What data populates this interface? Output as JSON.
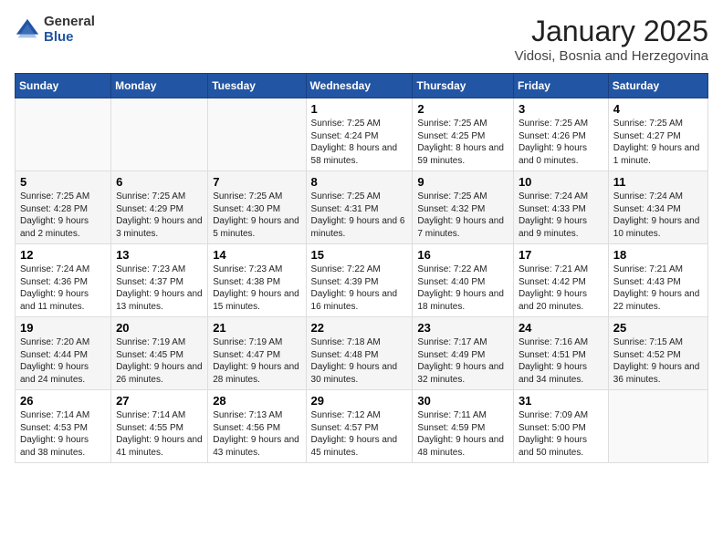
{
  "logo": {
    "general": "General",
    "blue": "Blue"
  },
  "title": "January 2025",
  "location": "Vidosi, Bosnia and Herzegovina",
  "days_of_week": [
    "Sunday",
    "Monday",
    "Tuesday",
    "Wednesday",
    "Thursday",
    "Friday",
    "Saturday"
  ],
  "weeks": [
    [
      {
        "day": "",
        "info": ""
      },
      {
        "day": "",
        "info": ""
      },
      {
        "day": "",
        "info": ""
      },
      {
        "day": "1",
        "info": "Sunrise: 7:25 AM\nSunset: 4:24 PM\nDaylight: 8 hours and 58 minutes."
      },
      {
        "day": "2",
        "info": "Sunrise: 7:25 AM\nSunset: 4:25 PM\nDaylight: 8 hours and 59 minutes."
      },
      {
        "day": "3",
        "info": "Sunrise: 7:25 AM\nSunset: 4:26 PM\nDaylight: 9 hours and 0 minutes."
      },
      {
        "day": "4",
        "info": "Sunrise: 7:25 AM\nSunset: 4:27 PM\nDaylight: 9 hours and 1 minute."
      }
    ],
    [
      {
        "day": "5",
        "info": "Sunrise: 7:25 AM\nSunset: 4:28 PM\nDaylight: 9 hours and 2 minutes."
      },
      {
        "day": "6",
        "info": "Sunrise: 7:25 AM\nSunset: 4:29 PM\nDaylight: 9 hours and 3 minutes."
      },
      {
        "day": "7",
        "info": "Sunrise: 7:25 AM\nSunset: 4:30 PM\nDaylight: 9 hours and 5 minutes."
      },
      {
        "day": "8",
        "info": "Sunrise: 7:25 AM\nSunset: 4:31 PM\nDaylight: 9 hours and 6 minutes."
      },
      {
        "day": "9",
        "info": "Sunrise: 7:25 AM\nSunset: 4:32 PM\nDaylight: 9 hours and 7 minutes."
      },
      {
        "day": "10",
        "info": "Sunrise: 7:24 AM\nSunset: 4:33 PM\nDaylight: 9 hours and 9 minutes."
      },
      {
        "day": "11",
        "info": "Sunrise: 7:24 AM\nSunset: 4:34 PM\nDaylight: 9 hours and 10 minutes."
      }
    ],
    [
      {
        "day": "12",
        "info": "Sunrise: 7:24 AM\nSunset: 4:36 PM\nDaylight: 9 hours and 11 minutes."
      },
      {
        "day": "13",
        "info": "Sunrise: 7:23 AM\nSunset: 4:37 PM\nDaylight: 9 hours and 13 minutes."
      },
      {
        "day": "14",
        "info": "Sunrise: 7:23 AM\nSunset: 4:38 PM\nDaylight: 9 hours and 15 minutes."
      },
      {
        "day": "15",
        "info": "Sunrise: 7:22 AM\nSunset: 4:39 PM\nDaylight: 9 hours and 16 minutes."
      },
      {
        "day": "16",
        "info": "Sunrise: 7:22 AM\nSunset: 4:40 PM\nDaylight: 9 hours and 18 minutes."
      },
      {
        "day": "17",
        "info": "Sunrise: 7:21 AM\nSunset: 4:42 PM\nDaylight: 9 hours and 20 minutes."
      },
      {
        "day": "18",
        "info": "Sunrise: 7:21 AM\nSunset: 4:43 PM\nDaylight: 9 hours and 22 minutes."
      }
    ],
    [
      {
        "day": "19",
        "info": "Sunrise: 7:20 AM\nSunset: 4:44 PM\nDaylight: 9 hours and 24 minutes."
      },
      {
        "day": "20",
        "info": "Sunrise: 7:19 AM\nSunset: 4:45 PM\nDaylight: 9 hours and 26 minutes."
      },
      {
        "day": "21",
        "info": "Sunrise: 7:19 AM\nSunset: 4:47 PM\nDaylight: 9 hours and 28 minutes."
      },
      {
        "day": "22",
        "info": "Sunrise: 7:18 AM\nSunset: 4:48 PM\nDaylight: 9 hours and 30 minutes."
      },
      {
        "day": "23",
        "info": "Sunrise: 7:17 AM\nSunset: 4:49 PM\nDaylight: 9 hours and 32 minutes."
      },
      {
        "day": "24",
        "info": "Sunrise: 7:16 AM\nSunset: 4:51 PM\nDaylight: 9 hours and 34 minutes."
      },
      {
        "day": "25",
        "info": "Sunrise: 7:15 AM\nSunset: 4:52 PM\nDaylight: 9 hours and 36 minutes."
      }
    ],
    [
      {
        "day": "26",
        "info": "Sunrise: 7:14 AM\nSunset: 4:53 PM\nDaylight: 9 hours and 38 minutes."
      },
      {
        "day": "27",
        "info": "Sunrise: 7:14 AM\nSunset: 4:55 PM\nDaylight: 9 hours and 41 minutes."
      },
      {
        "day": "28",
        "info": "Sunrise: 7:13 AM\nSunset: 4:56 PM\nDaylight: 9 hours and 43 minutes."
      },
      {
        "day": "29",
        "info": "Sunrise: 7:12 AM\nSunset: 4:57 PM\nDaylight: 9 hours and 45 minutes."
      },
      {
        "day": "30",
        "info": "Sunrise: 7:11 AM\nSunset: 4:59 PM\nDaylight: 9 hours and 48 minutes."
      },
      {
        "day": "31",
        "info": "Sunrise: 7:09 AM\nSunset: 5:00 PM\nDaylight: 9 hours and 50 minutes."
      },
      {
        "day": "",
        "info": ""
      }
    ]
  ]
}
